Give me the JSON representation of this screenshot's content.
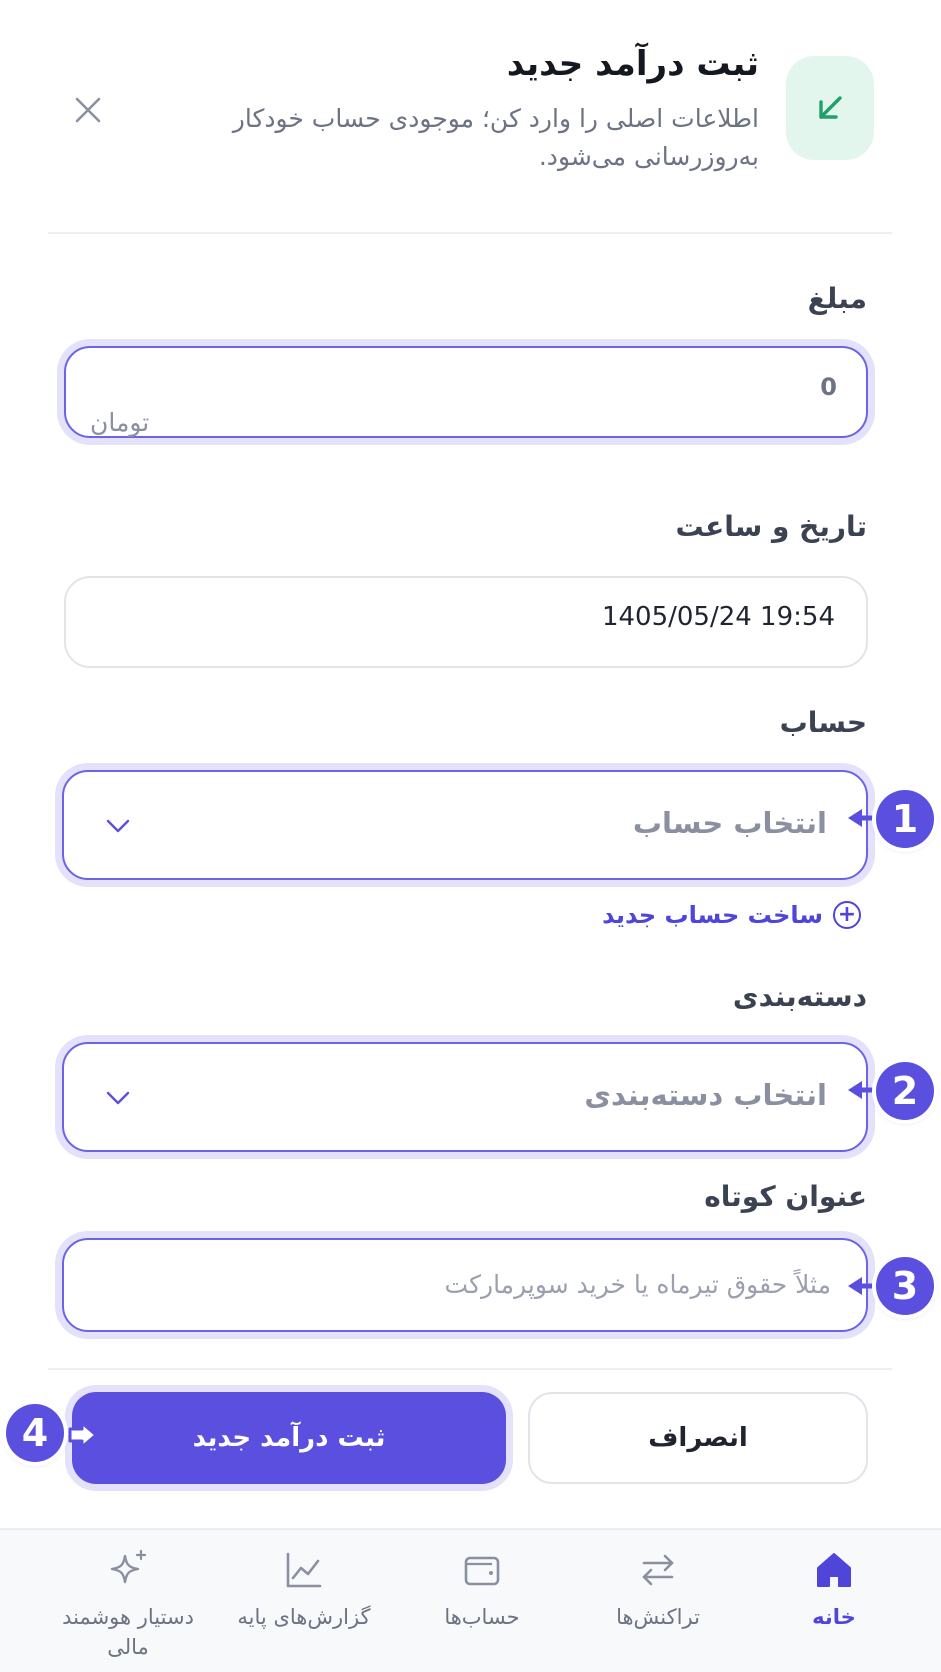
{
  "header": {
    "title": "ثبت درآمد جدید",
    "subtitle": "اطلاعات اصلی را وارد کن؛ موجودی حساب خودکار به‌روزرسانی می‌شود.",
    "icon": "arrow-down-left-icon",
    "icon_bg": "#e3f6ee",
    "icon_color": "#22a06b"
  },
  "amount": {
    "label": "مبلغ",
    "value": "0",
    "unit": "تومان"
  },
  "datetime": {
    "label": "تاریخ و ساعت",
    "value": "1405/05/24 19:54"
  },
  "account": {
    "label": "حساب",
    "placeholder": "انتخاب حساب",
    "create_link": "ساخت حساب جدید"
  },
  "category": {
    "label": "دسته‌بندی",
    "placeholder": "انتخاب دسته‌بندی"
  },
  "short_title": {
    "label": "عنوان کوتاه",
    "placeholder": "مثلاً حقوق تیرماه یا خرید سوپرمارکت"
  },
  "steps": [
    "1",
    "2",
    "3",
    "4"
  ],
  "actions": {
    "submit_label": "ثبت درآمد جدید",
    "cancel_label": "انصراف"
  },
  "bottom_nav": {
    "items": [
      {
        "label": "خانه",
        "icon": "home-icon",
        "active": true
      },
      {
        "label": "تراکنش‌ها",
        "icon": "swap-arrows-icon",
        "active": false
      },
      {
        "label": "حساب‌ها",
        "icon": "wallet-icon",
        "active": false
      },
      {
        "label": "گزارش‌های پایه",
        "icon": "chart-line-icon",
        "active": false
      },
      {
        "label": "دستیار هوشمند مالی",
        "icon": "sparkle-icon",
        "active": false
      }
    ]
  },
  "colors": {
    "accent": "#5b4fe0",
    "link": "#4f46d9",
    "focus_ring": "#e4e2fb"
  }
}
